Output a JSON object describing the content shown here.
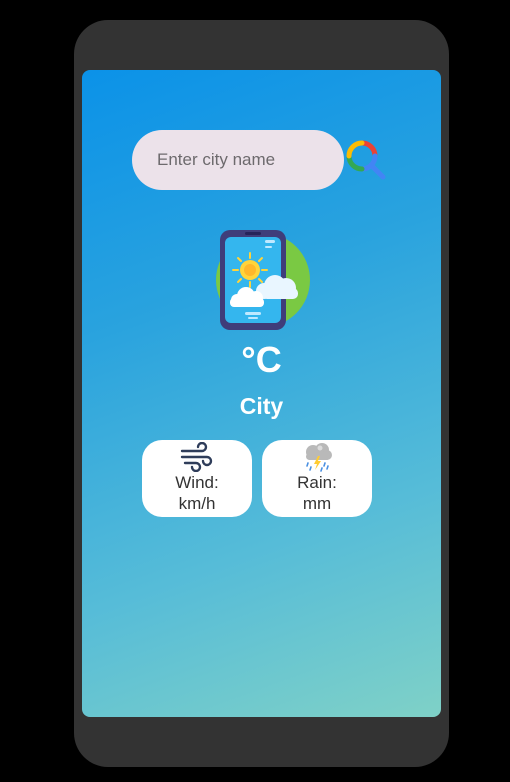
{
  "search": {
    "placeholder": "Enter city name",
    "value": ""
  },
  "weather": {
    "temperature": "",
    "temperature_unit": "°C",
    "city": "City"
  },
  "details": {
    "wind": {
      "label": "Wind:",
      "value": "",
      "unit": "km/h",
      "icon": "wind-icon"
    },
    "rain": {
      "label": "Rain:",
      "value": "",
      "unit": "mm",
      "icon": "rain-cloud-icon"
    }
  },
  "colors": {
    "background": "#000000",
    "phone_frame": "#333333",
    "screen_gradient_start": "#0b92e8",
    "screen_gradient_end": "#7fd1c7",
    "search_field": "#ece2ea",
    "card": "#ffffff",
    "text_light": "#ffffff",
    "text_dark": "#333333"
  }
}
